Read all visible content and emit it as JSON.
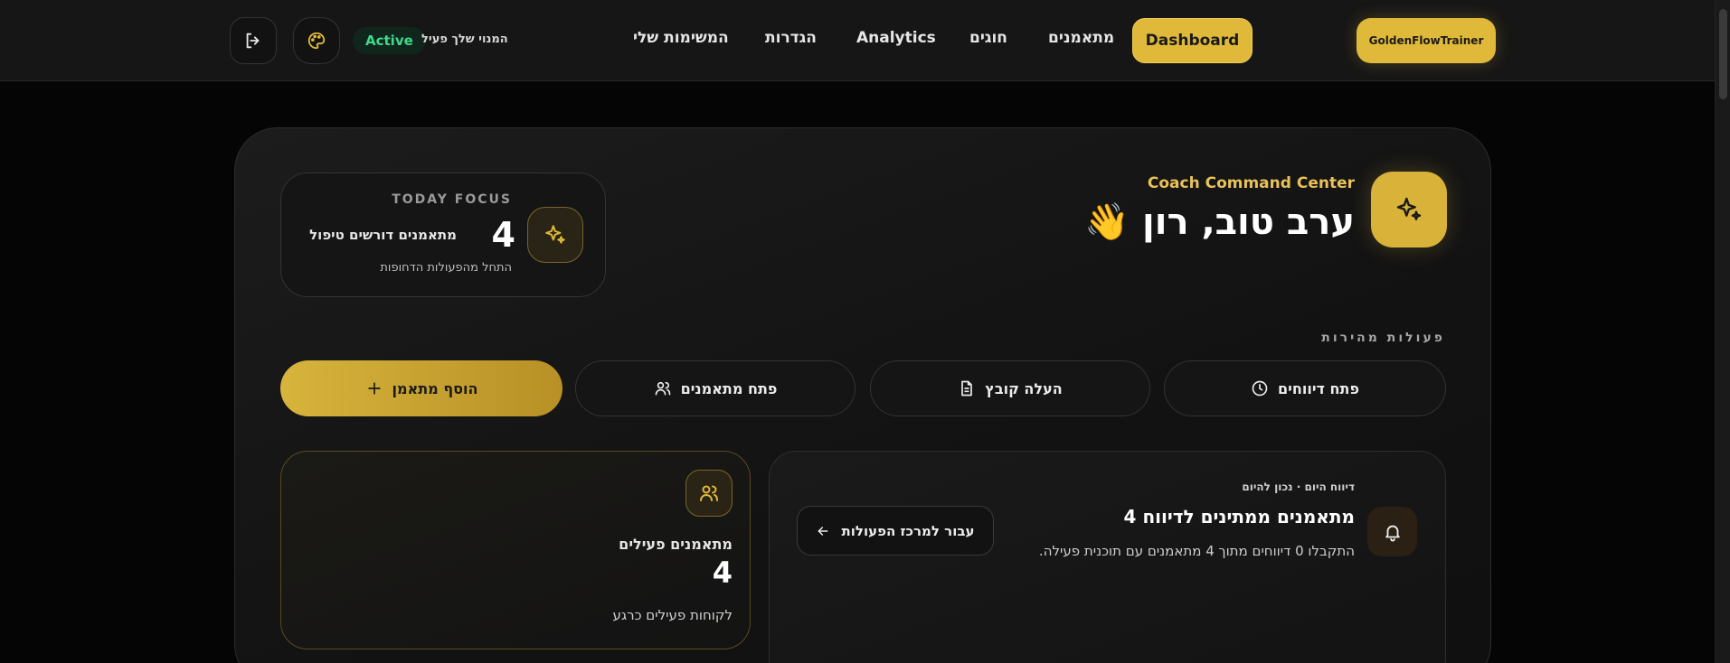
{
  "header": {
    "brand": "GoldenFlowTrainer",
    "nav": {
      "dashboard": "Dashboard",
      "trainees": "מתאמנים",
      "circles": "חוגים",
      "analytics": "Analytics",
      "settings": "הגדרות",
      "my_tasks": "המשימות שלי"
    },
    "subscription_status": "המנוי שלך פעיל",
    "active_badge": "Active",
    "theme_icon": "palette-icon",
    "logout_icon": "logout-icon"
  },
  "hero": {
    "kicker": "Coach Command Center",
    "greeting": "ערב טוב, רון 👋",
    "icon": "sparkles-icon"
  },
  "today_focus": {
    "label": "TODAY FOCUS",
    "count": "4",
    "text": "מתאמנים דורשים טיפול",
    "subtext": "התחל מהפעולות הדחופות",
    "icon": "sparkles-icon"
  },
  "quick_actions": {
    "label": "פעולות מהירות",
    "items": [
      {
        "label": "פתח דיווחים",
        "icon": "clock-icon"
      },
      {
        "label": "העלה קובץ",
        "icon": "file-icon"
      },
      {
        "label": "פתח מתאמנים",
        "icon": "users-icon"
      },
      {
        "label": "הוסף מתאמן",
        "icon": "plus-icon"
      }
    ]
  },
  "daily_report": {
    "meta": "דיווח היום · נכון להיום",
    "title": "4 מתאמנים ממתינים לדיווח",
    "description": "התקבלו 0 דיווחים מתוך 4 מתאמנים עם תוכנית פעילה.",
    "button": "עבור למרכז הפעולות",
    "icon": "bell-icon"
  },
  "active_trainees": {
    "label": "מתאמנים פעילים",
    "value": "4",
    "subtext": "לקוחות פעילים כרגע",
    "icon": "users-icon"
  },
  "colors": {
    "accent": "#e0b93a",
    "active_green": "#3fd98a",
    "background": "#050505"
  }
}
